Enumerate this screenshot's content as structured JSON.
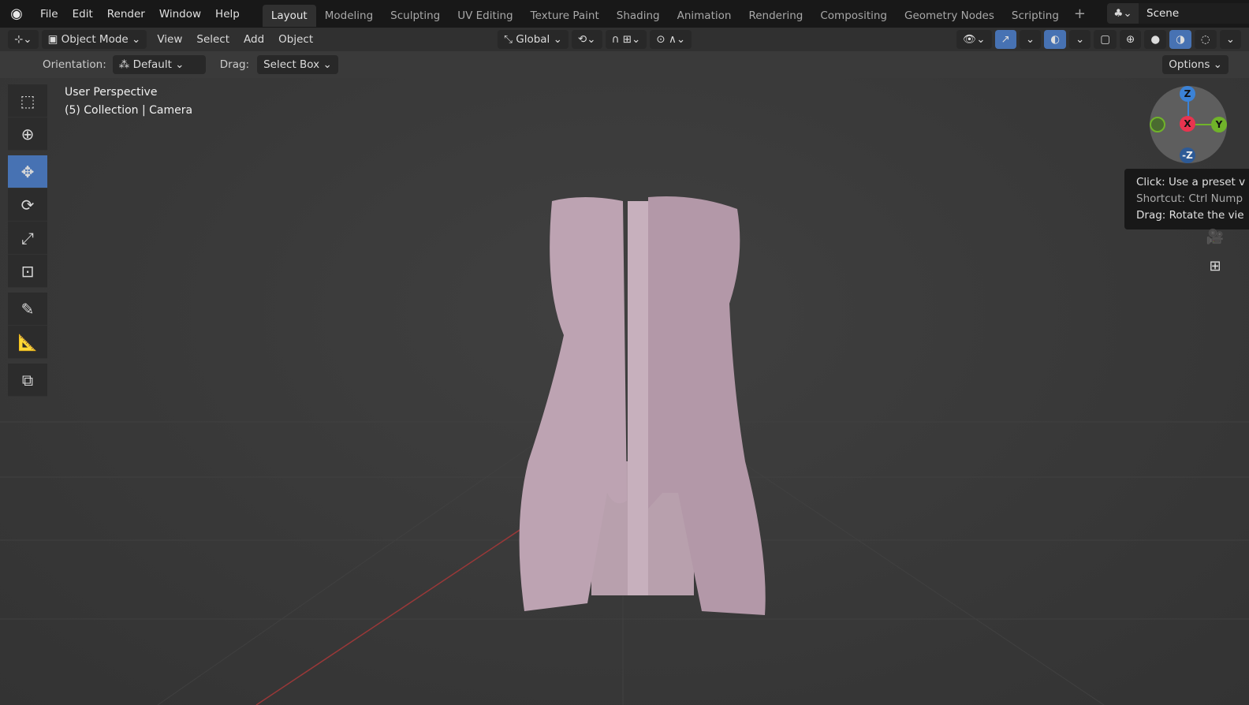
{
  "topbar": {
    "menus": [
      "File",
      "Edit",
      "Render",
      "Window",
      "Help"
    ],
    "workspaces": [
      "Layout",
      "Modeling",
      "Sculpting",
      "UV Editing",
      "Texture Paint",
      "Shading",
      "Animation",
      "Rendering",
      "Compositing",
      "Geometry Nodes",
      "Scripting"
    ],
    "active_workspace": "Layout",
    "scene": "Scene"
  },
  "header": {
    "mode": "Object Mode",
    "menus": [
      "View",
      "Select",
      "Add",
      "Object"
    ],
    "transform_orientation": "Global"
  },
  "tool_settings": {
    "orientation_label": "Orientation:",
    "orientation_value": "Default",
    "drag_label": "Drag:",
    "drag_value": "Select Box",
    "options": "Options"
  },
  "viewport": {
    "view_name": "User Perspective",
    "collection": "(5) Collection | Camera"
  },
  "gizmo": {
    "z": "Z",
    "x": "X",
    "y": "Y",
    "neg_z": "-Z"
  },
  "tooltip": {
    "line1": "Click: Use a preset v",
    "line2": "Shortcut: Ctrl Nump",
    "line3": "Drag: Rotate the vie"
  },
  "colors": {
    "accent": "#4772b3",
    "x_axis": "#e8344f",
    "y_axis": "#70b32a",
    "z_axis": "#3b82d6"
  }
}
